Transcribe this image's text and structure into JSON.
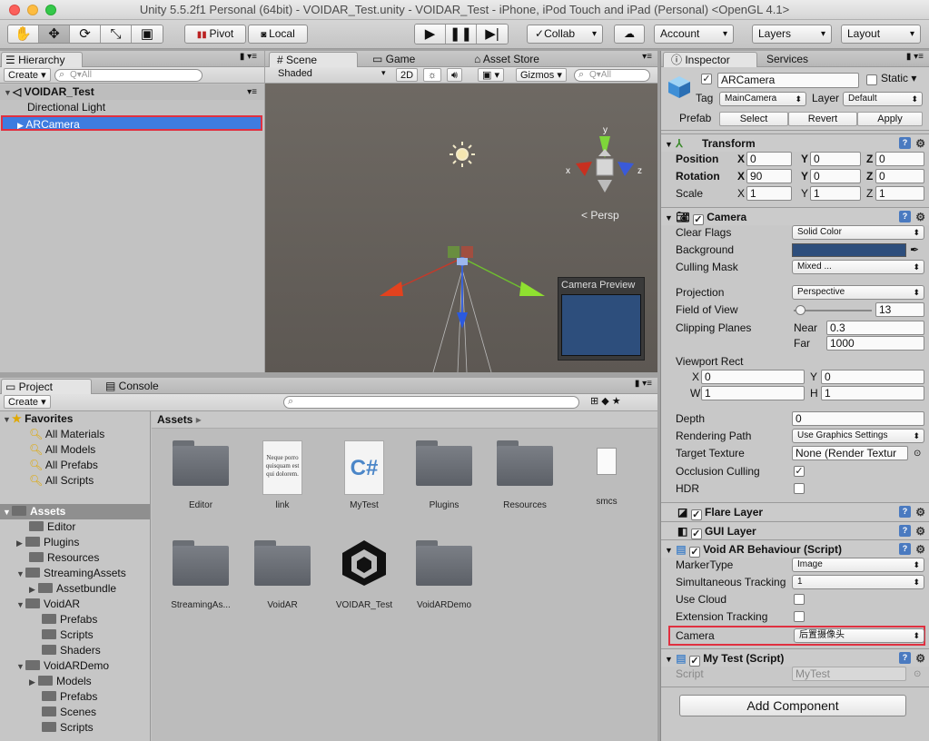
{
  "window": {
    "title": "Unity 5.5.2f1 Personal (64bit) - VOIDAR_Test.unity - VOIDAR_Test - iPhone, iPod Touch and iPad (Personal) <OpenGL 4.1>"
  },
  "toolbar": {
    "pivot": "Pivot",
    "local": "Local",
    "collab": "Collab",
    "account": "Account",
    "layers": "Layers",
    "layout": "Layout"
  },
  "hierarchy": {
    "tab": "Hierarchy",
    "create": "Create",
    "search_placeholder": "Q▾All",
    "scene": "VOIDAR_Test",
    "items": [
      "Directional Light",
      "ARCamera"
    ]
  },
  "scene": {
    "tabs": [
      "Scene",
      "Game",
      "Asset Store"
    ],
    "shading": "Shaded",
    "mode2d": "2D",
    "gizmos": "Gizmos",
    "search": "Q▾All",
    "persp": "Persp",
    "preview_title": "Camera Preview",
    "axes": {
      "x": "x",
      "y": "y",
      "z": "z"
    }
  },
  "project": {
    "tabs": [
      "Project",
      "Console"
    ],
    "create": "Create",
    "favorites_label": "Favorites",
    "favorites": [
      "All Materials",
      "All Models",
      "All Prefabs",
      "All Scripts"
    ],
    "tree": [
      "Assets",
      "Editor",
      "Plugins",
      "Resources",
      "StreamingAssets",
      "Assetbundle",
      "VoidAR",
      "Prefabs",
      "Scripts",
      "Shaders",
      "VoidARDemo",
      "Models",
      "Prefabs",
      "Scenes",
      "Scripts"
    ],
    "breadcrumb": "Assets",
    "assets": [
      "Editor",
      "link",
      "MyTest",
      "Plugins",
      "Resources",
      "smcs",
      "StreamingAs...",
      "VoidAR",
      "VOIDAR_Test",
      "VoidARDemo"
    ],
    "link_text": "Neque porro quisquam est qui dolorem."
  },
  "inspector": {
    "tabs": [
      "Inspector",
      "Services"
    ],
    "name": "ARCamera",
    "static": "Static",
    "tag_label": "Tag",
    "tag": "MainCamera",
    "layer_label": "Layer",
    "layer": "Default",
    "prefab_label": "Prefab",
    "select": "Select",
    "revert": "Revert",
    "apply": "Apply",
    "transform": {
      "title": "Transform",
      "position": "Position",
      "rotation": "Rotation",
      "scale": "Scale",
      "px": "0",
      "py": "0",
      "pz": "0",
      "rx": "90",
      "ry": "0",
      "rz": "0",
      "sx": "1",
      "sy": "1",
      "sz": "1",
      "x": "X",
      "y": "Y",
      "z": "Z"
    },
    "camera": {
      "title": "Camera",
      "clear_flags": "Clear Flags",
      "clear_flags_val": "Solid Color",
      "background": "Background",
      "background_color": "#2d4e7c",
      "culling_mask": "Culling Mask",
      "culling_mask_val": "Mixed ...",
      "projection": "Projection",
      "projection_val": "Perspective",
      "fov": "Field of View",
      "fov_val": "13",
      "fov_fraction": 0.08,
      "clipping": "Clipping Planes",
      "near_label": "Near",
      "near": "0.3",
      "far_label": "Far",
      "far": "1000",
      "viewport": "Viewport Rect",
      "vx_label": "X",
      "vx": "0",
      "vy_label": "Y",
      "vy": "0",
      "vw_label": "W",
      "vw": "1",
      "vh_label": "H",
      "vh": "1",
      "depth": "Depth",
      "depth_val": "0",
      "rendering_path": "Rendering Path",
      "rendering_path_val": "Use Graphics Settings",
      "target_texture": "Target Texture",
      "target_texture_val": "None (Render Textur",
      "occlusion": "Occlusion Culling",
      "hdr": "HDR"
    },
    "flare": "Flare Layer",
    "gui": "GUI Layer",
    "voidar": {
      "title": "Void AR Behaviour (Script)",
      "marker_type": "MarkerType",
      "marker_type_val": "Image",
      "simultaneous": "Simultaneous Tracking",
      "simultaneous_val": "1",
      "use_cloud": "Use Cloud",
      "extension": "Extension Tracking",
      "camera": "Camera",
      "camera_val": "后置摄像头"
    },
    "mytest": {
      "title": "My Test (Script)",
      "script": "Script",
      "script_val": "MyTest"
    },
    "add_component": "Add Component"
  },
  "colors": {
    "selection": "#3e7ce0",
    "highlight_red": "#e03040",
    "scene_sky": "#6b6560"
  }
}
